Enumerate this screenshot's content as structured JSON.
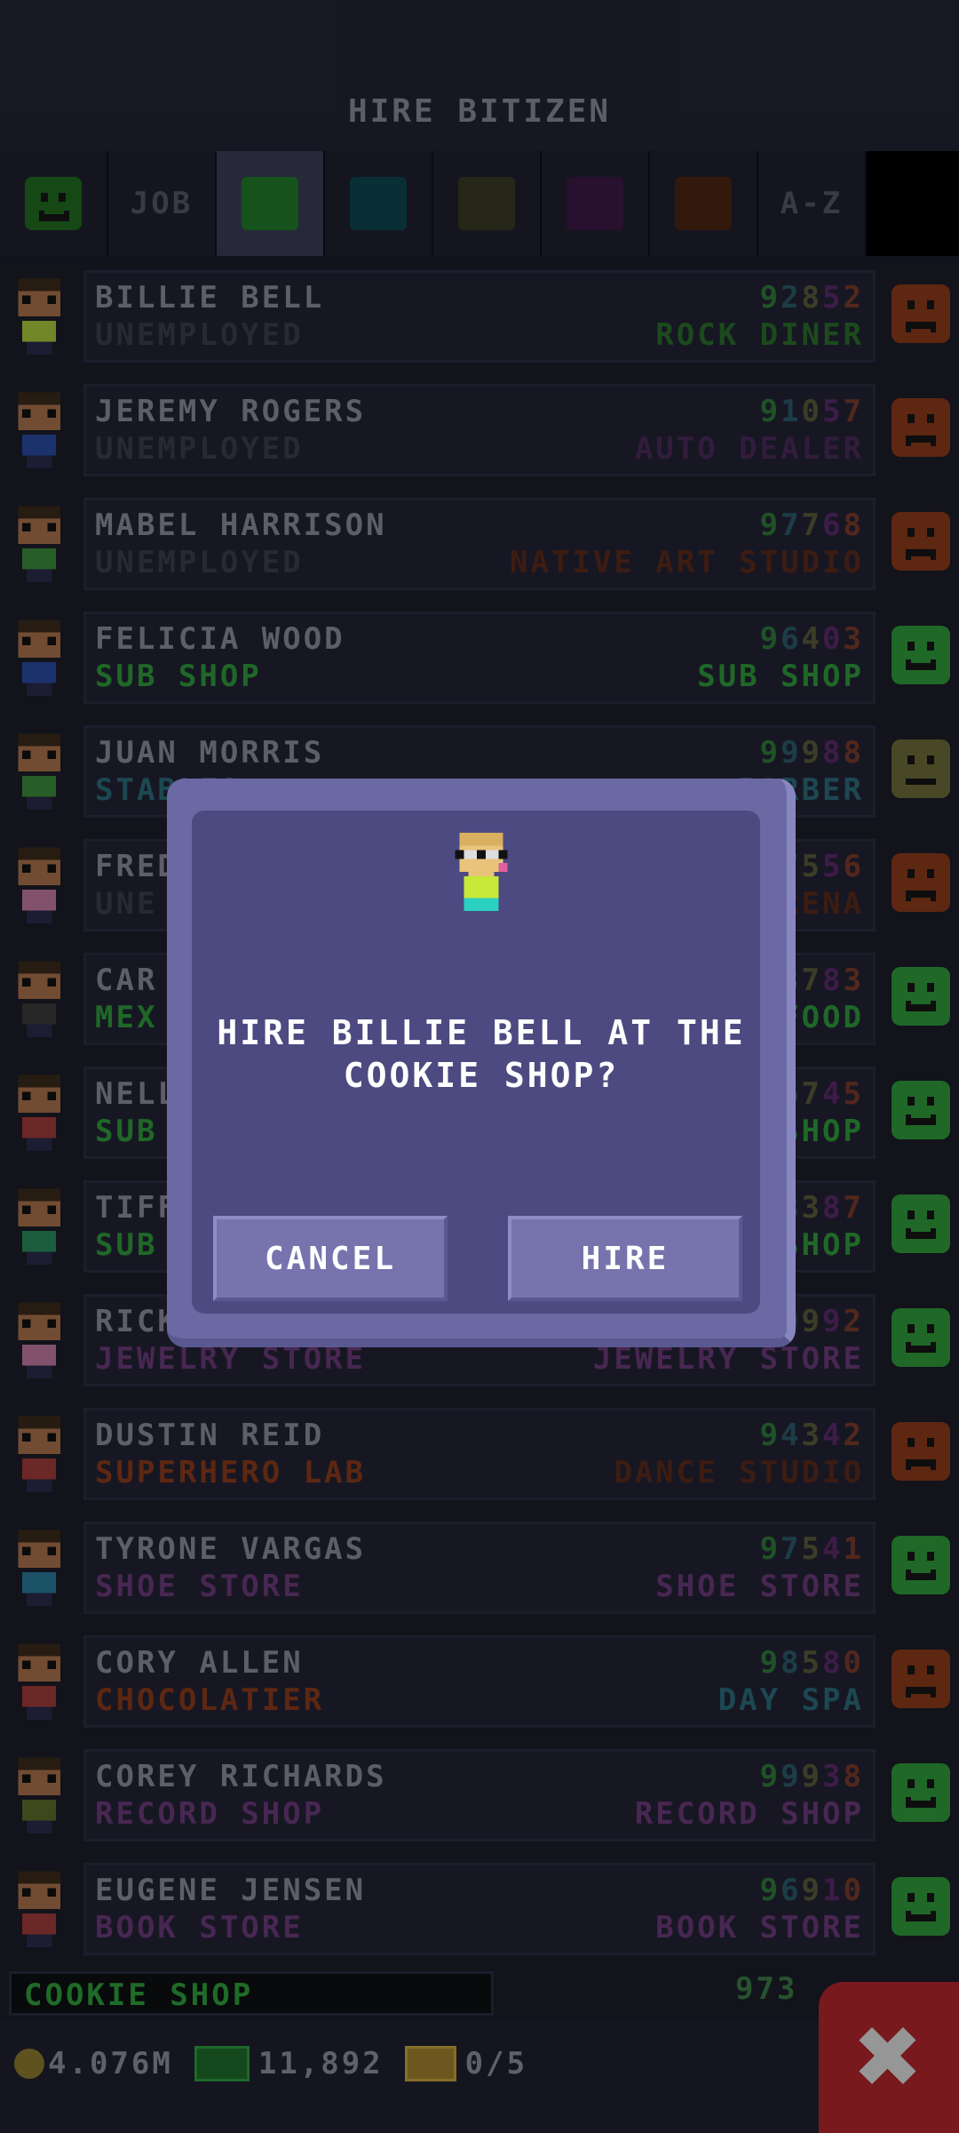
{
  "header": {
    "title": "HIRE BITIZEN"
  },
  "tabs": [
    {
      "kind": "icon",
      "icon": "happy-face-icon",
      "color": "#1f6a1f"
    },
    {
      "kind": "text",
      "label": "JOB"
    },
    {
      "kind": "swatch",
      "color": "#1f7a2a",
      "active": true
    },
    {
      "kind": "swatch",
      "color": "#0f4550"
    },
    {
      "kind": "swatch",
      "color": "#3a3a26"
    },
    {
      "kind": "swatch",
      "color": "#3a1a46"
    },
    {
      "kind": "swatch",
      "color": "#4a2414"
    },
    {
      "kind": "text",
      "label": "A-Z"
    }
  ],
  "rows": [
    {
      "name": "BILLIE BELL",
      "job": "UNEMPLOYED",
      "job_color": "#3d3d4d",
      "stats": [
        "9",
        "2",
        "8",
        "5",
        "2"
      ],
      "dream": "ROCK DINER",
      "dream_color": "#2a6e2a",
      "mood": "sad",
      "shirt": "#a8c83a"
    },
    {
      "name": "JEREMY ROGERS",
      "job": "UNEMPLOYED",
      "job_color": "#3d3d4d",
      "stats": [
        "9",
        "1",
        "0",
        "5",
        "7"
      ],
      "dream": "AUTO DEALER",
      "dream_color": "#4a2a5a",
      "mood": "sad",
      "shirt": "#2a4aa0"
    },
    {
      "name": "MABEL HARRISON",
      "job": "UNEMPLOYED",
      "job_color": "#3d3d4d",
      "stats": [
        "9",
        "7",
        "7",
        "6",
        "8"
      ],
      "dream": "NATIVE ART STUDIO",
      "dream_color": "#5a2a1a",
      "mood": "sad",
      "shirt": "#3a8a3a"
    },
    {
      "name": "FELICIA WOOD",
      "job": "SUB SHOP",
      "job_color": "#2f9a3a",
      "stats": [
        "9",
        "6",
        "4",
        "0",
        "3"
      ],
      "dream": "SUB SHOP",
      "dream_color": "#2f9a3a",
      "mood": "happy",
      "shirt": "#2a4aa0"
    },
    {
      "name": "JUAN MORRIS",
      "job": "STABLES",
      "job_color": "#2a6a7a",
      "stats": [
        "9",
        "9",
        "9",
        "8",
        "8"
      ],
      "dream": "BARBER",
      "dream_color": "#2a6a7a",
      "mood": "neutral",
      "shirt": "#3a8a3a"
    },
    {
      "name": "FRED",
      "job": "UNE",
      "job_color": "#3d3d4d",
      "stats": [
        "9",
        "7",
        "5",
        "5",
        "6"
      ],
      "dream": "ARENA",
      "dream_color": "#5a2a1a",
      "mood": "sad",
      "shirt": "#c07aa0"
    },
    {
      "name": "CAR",
      "job": "MEX",
      "job_color": "#2f9a3a",
      "stats": [
        "9",
        "8",
        "7",
        "8",
        "3"
      ],
      "dream": "FOOD",
      "dream_color": "#2f9a3a",
      "mood": "happy",
      "shirt": "#3a3a3a"
    },
    {
      "name": "NELL",
      "job": "SUB",
      "job_color": "#2f9a3a",
      "stats": [
        "9",
        "6",
        "7",
        "4",
        "5"
      ],
      "dream": "SHOP",
      "dream_color": "#2f9a3a",
      "mood": "happy",
      "shirt": "#a03a3a"
    },
    {
      "name": "TIFF",
      "job": "SUB",
      "job_color": "#2f9a3a",
      "stats": [
        "9",
        "8",
        "3",
        "8",
        "7"
      ],
      "dream": "SHOP",
      "dream_color": "#2f9a3a",
      "mood": "happy",
      "shirt": "#2a8a5a"
    },
    {
      "name": "RICK",
      "job": "JEWELRY STORE",
      "job_color": "#6a3a7a",
      "stats": [
        "9",
        "9",
        "9",
        "9",
        "2"
      ],
      "dream": "JEWELRY STORE",
      "dream_color": "#6a3a7a",
      "mood": "happy",
      "shirt": "#c07aa0"
    },
    {
      "name": "DUSTIN REID",
      "job": "SUPERHERO LAB",
      "job_color": "#8a3a1a",
      "stats": [
        "9",
        "4",
        "3",
        "4",
        "2"
      ],
      "dream": "DANCE STUDIO",
      "dream_color": "#5a2a1a",
      "mood": "sad",
      "shirt": "#a03a3a"
    },
    {
      "name": "TYRONE VARGAS",
      "job": "SHOE STORE",
      "job_color": "#6a3a7a",
      "stats": [
        "9",
        "7",
        "5",
        "4",
        "1"
      ],
      "dream": "SHOE STORE",
      "dream_color": "#6a3a7a",
      "mood": "happy",
      "shirt": "#2a7a9a"
    },
    {
      "name": "CORY ALLEN",
      "job": "CHOCOLATIER",
      "job_color": "#8a3a1a",
      "stats": [
        "9",
        "8",
        "5",
        "8",
        "0"
      ],
      "dream": "DAY SPA",
      "dream_color": "#2a6a7a",
      "mood": "sad",
      "shirt": "#a03a3a"
    },
    {
      "name": "COREY RICHARDS",
      "job": "RECORD SHOP",
      "job_color": "#6a3a7a",
      "stats": [
        "9",
        "9",
        "9",
        "3",
        "8"
      ],
      "dream": "RECORD SHOP",
      "dream_color": "#6a3a7a",
      "mood": "happy",
      "shirt": "#5a6a2a"
    },
    {
      "name": "EUGENE JENSEN",
      "job": "BOOK STORE",
      "job_color": "#6a3a7a",
      "stats": [
        "9",
        "6",
        "9",
        "1",
        "0"
      ],
      "dream": "BOOK STORE",
      "dream_color": "#6a3a7a",
      "mood": "happy",
      "shirt": "#a03a3a"
    }
  ],
  "stat_colors": [
    "#2f7a3a",
    "#2a5a6a",
    "#5a5a3a",
    "#5a2a6a",
    "#7a3a2a"
  ],
  "mood_colors": {
    "happy": "#2f9a3a",
    "sad": "#8a3a1a",
    "neutral": "#6a6a3a"
  },
  "dialog": {
    "message": "HIRE BILLIE BELL AT THE COOKIE SHOP?",
    "cancel_label": "CANCEL",
    "hire_label": "HIRE"
  },
  "footer": {
    "shop_name": "COOKIE SHOP",
    "shop_stats": "973",
    "coins": "4.076M",
    "bux": "11,892",
    "tickets": "0/5"
  }
}
